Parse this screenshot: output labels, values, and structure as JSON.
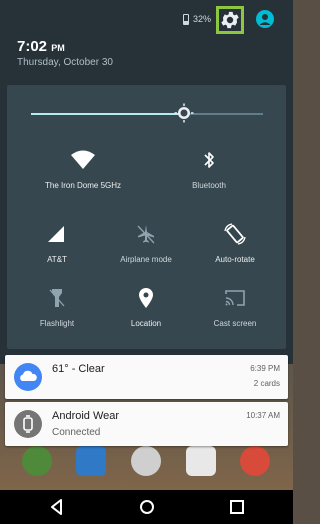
{
  "status": {
    "battery_percent": "32%",
    "time": "7:02",
    "time_ampm": "PM",
    "date": "Thursday, October 30"
  },
  "brightness": {
    "level": 0.66
  },
  "tiles": [
    {
      "label": "The Iron Dome 5GHz",
      "icon": "wifi-icon"
    },
    {
      "label": "Bluetooth",
      "icon": "bluetooth-icon"
    },
    {
      "label": "AT&T",
      "icon": "cellular-signal-icon"
    },
    {
      "label": "Airplane mode",
      "icon": "airplane-mode-icon"
    },
    {
      "label": "Auto-rotate",
      "icon": "auto-rotate-icon"
    },
    {
      "label": "Flashlight",
      "icon": "flashlight-icon"
    },
    {
      "label": "Location",
      "icon": "location-icon"
    },
    {
      "label": "Cast screen",
      "icon": "cast-screen-icon"
    }
  ],
  "notifications": [
    {
      "title": "61° - Clear",
      "time": "6:39 PM",
      "extra": "2 cards",
      "icon": "weather-cloud-icon",
      "icon_color": "#4285f4"
    },
    {
      "title": "Android Wear",
      "subtitle": "Connected",
      "time": "10:37 AM",
      "icon": "watch-icon",
      "icon_color": "#757575"
    }
  ],
  "colors": {
    "shade_bg": "#263238",
    "panel_bg": "#37474f",
    "accent": "#b2ebf2",
    "highlight": "#8dc63f"
  }
}
